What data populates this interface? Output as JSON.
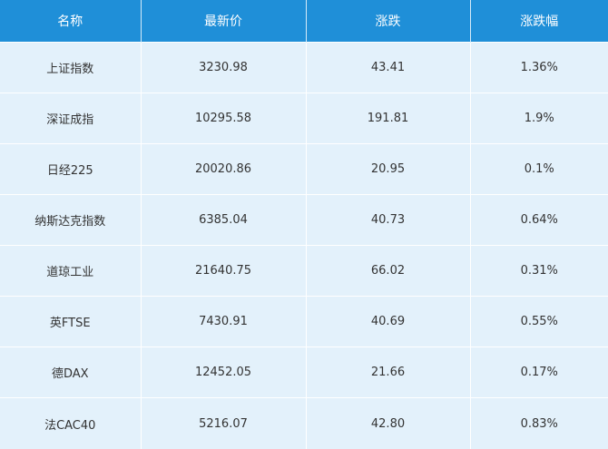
{
  "table": {
    "headers": [
      "名称",
      "最新价",
      "涨跌",
      "涨跌幅"
    ],
    "rows": [
      [
        "上证指数",
        "3230.98",
        "43.41",
        "1.36%"
      ],
      [
        "深证成指",
        "10295.58",
        "191.81",
        "1.9%"
      ],
      [
        "日经225",
        "20020.86",
        "20.95",
        "0.1%"
      ],
      [
        "纳斯达克指数",
        "6385.04",
        "40.73",
        "0.64%"
      ],
      [
        "道琼工业",
        "21640.75",
        "66.02",
        "0.31%"
      ],
      [
        "英FTSE",
        "7430.91",
        "40.69",
        "0.55%"
      ],
      [
        "德DAX",
        "12452.05",
        "21.66",
        "0.17%"
      ],
      [
        "法CAC40",
        "5216.07",
        "42.80",
        "0.83%"
      ]
    ]
  },
  "colors": {
    "header_bg": "#1f8fd8",
    "row_bg": "#e3f1fb"
  }
}
